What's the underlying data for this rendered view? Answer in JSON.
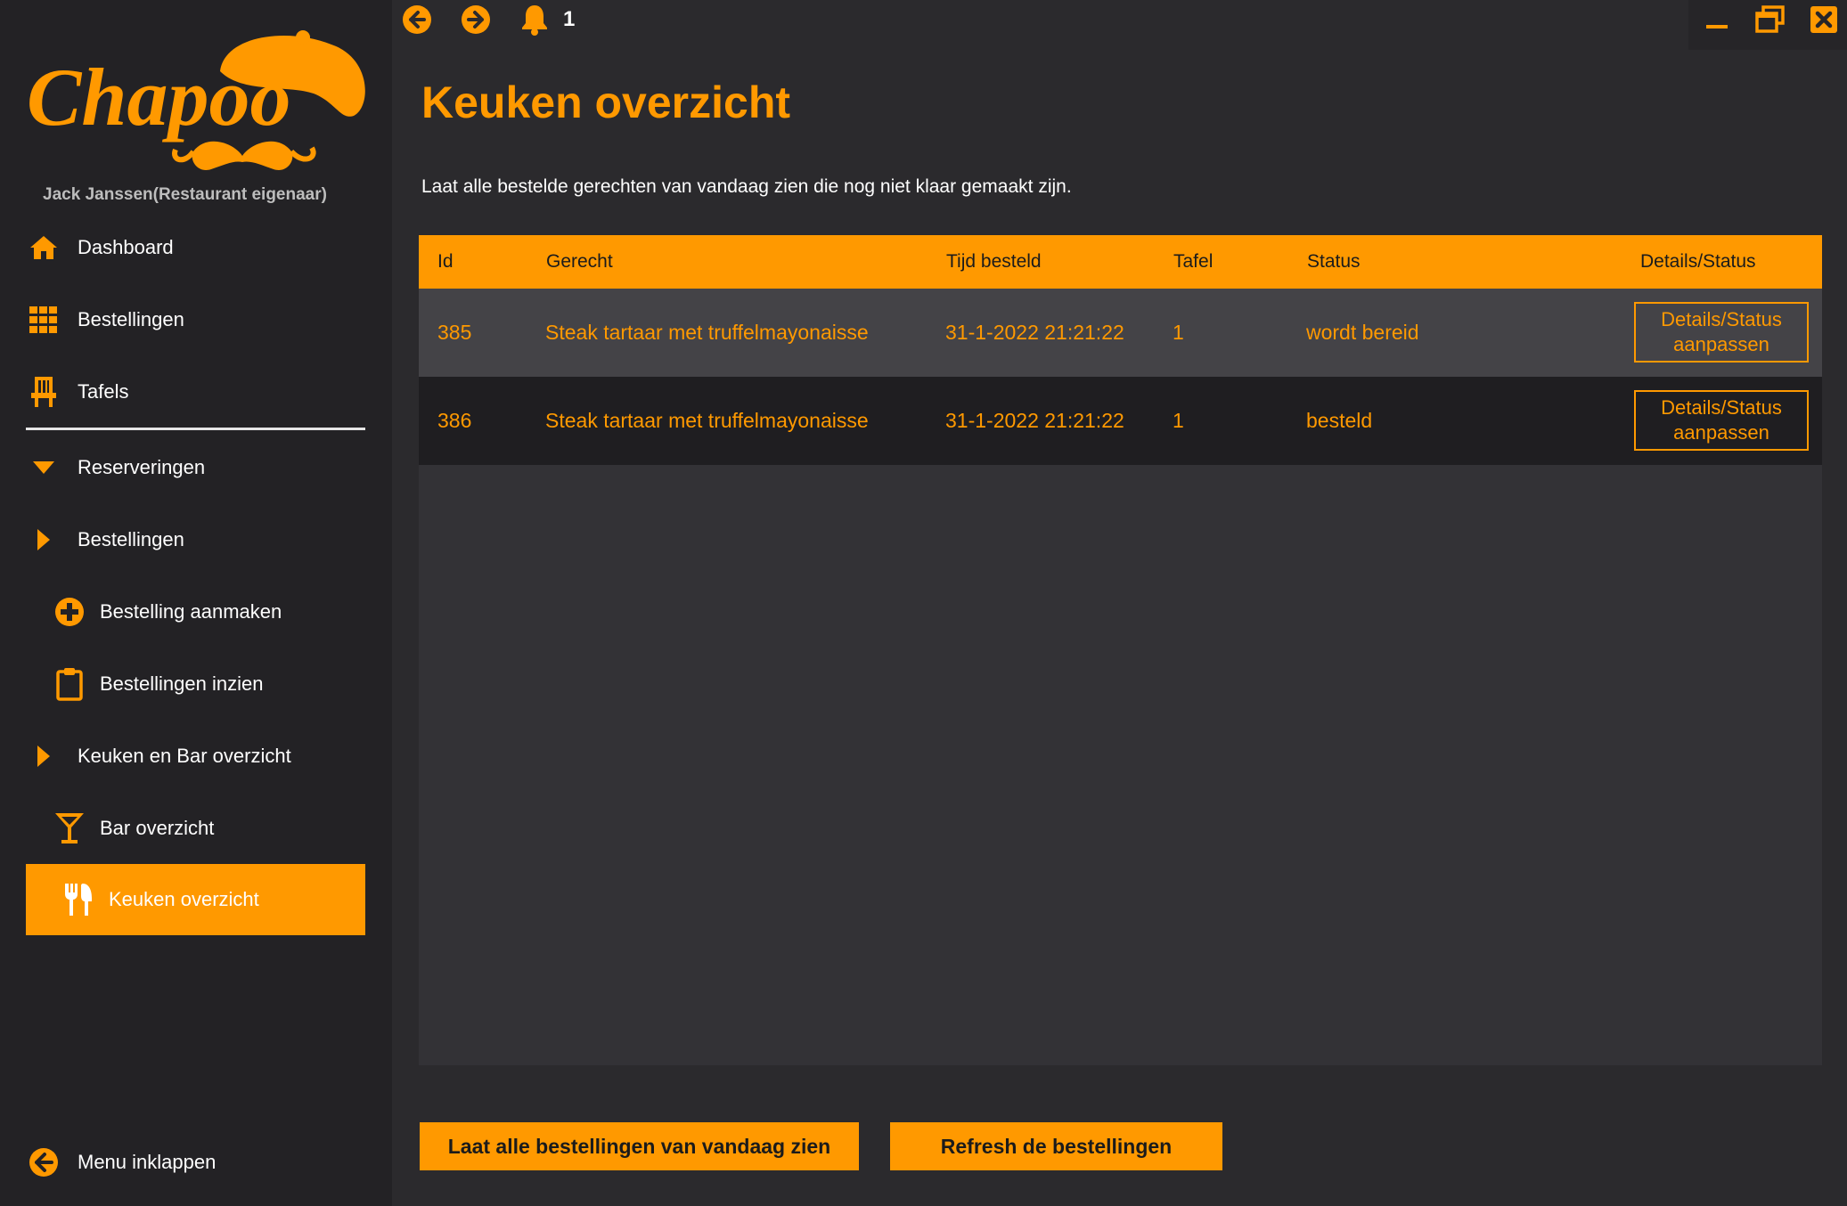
{
  "brand": {
    "logo_text": "Chapoo",
    "accent": "#ff9900"
  },
  "user": {
    "label": "Jack Janssen(Restaurant eigenaar)"
  },
  "sidebar": {
    "items": [
      {
        "label": "Dashboard",
        "icon": "home-icon"
      },
      {
        "label": "Bestellingen",
        "icon": "grid-icon"
      },
      {
        "label": "Tafels",
        "icon": "chair-icon"
      },
      {
        "label": "Reserveringen",
        "icon": "caret-down-icon"
      },
      {
        "label": "Bestellingen",
        "icon": "caret-right-icon"
      },
      {
        "label": "Bestelling aanmaken",
        "icon": "plus-circle-icon"
      },
      {
        "label": "Bestellingen inzien",
        "icon": "clipboard-icon"
      },
      {
        "label": "Keuken en Bar overzicht",
        "icon": "caret-right-icon"
      },
      {
        "label": "Bar overzicht",
        "icon": "cocktail-icon"
      },
      {
        "label": "Keuken overzicht",
        "icon": "utensils-icon",
        "active": true
      }
    ],
    "collapse_label": "Menu inklappen"
  },
  "topbar": {
    "notification_count": "1"
  },
  "page": {
    "title": "Keuken overzicht",
    "description": "Laat alle bestelde gerechten van vandaag zien die nog niet klaar gemaakt zijn."
  },
  "table": {
    "headers": [
      "Id",
      "Gerecht",
      "Tijd besteld",
      "Tafel",
      "Status",
      "Details/Status"
    ],
    "rows": [
      {
        "id": "385",
        "dish": "Steak tartaar met truffelmayonaisse",
        "time": "31-1-2022 21:21:22",
        "table": "1",
        "status": "wordt bereid",
        "button": "Details/Status aanpassen"
      },
      {
        "id": "386",
        "dish": "Steak tartaar met truffelmayonaisse",
        "time": "31-1-2022 21:21:22",
        "table": "1",
        "status": "besteld",
        "button": "Details/Status aanpassen"
      }
    ]
  },
  "actions": {
    "show_all_label": "Laat alle bestellingen van vandaag zien",
    "refresh_label": "Refresh de bestellingen"
  }
}
